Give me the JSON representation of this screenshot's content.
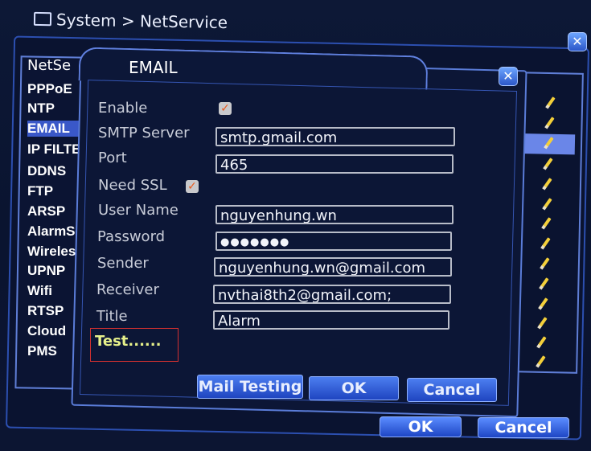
{
  "outer": {
    "title": "System > NetService",
    "close": "✕",
    "list_header": "NetSe",
    "list_items": [
      "PPPoE",
      "NTP",
      "EMAIL",
      "IP FILTER",
      "DDNS",
      "FTP",
      "ARSP",
      "AlarmServer",
      "Wireless",
      "UPNP",
      "Wifi",
      "RTSP",
      "Cloud",
      "PMS"
    ],
    "selected_item": "EMAIL",
    "ok_button": "OK",
    "cancel_button": "Cancel",
    "edit_icon": "pencil-icon"
  },
  "email": {
    "title": "EMAIL",
    "close": "✕",
    "labels": {
      "enable": "Enable",
      "smtp_server": "SMTP Server",
      "port": "Port",
      "need_ssl": "Need SSL",
      "user_name": "User Name",
      "password": "Password",
      "sender": "Sender",
      "receiver": "Receiver",
      "title": "Title"
    },
    "values": {
      "enable": true,
      "need_ssl": true,
      "smtp_server": "smtp.gmail.com",
      "port": "465",
      "user_name": "nguyenhung.wn",
      "password": "●●●●●●●",
      "sender": "nguyenhung.wn@gmail.com",
      "receiver": "nvthai8th2@gmail.com;",
      "title": "Alarm"
    },
    "check_mark": "✓",
    "test_text": "Test......",
    "mail_testing_button": "Mail Testing",
    "ok_button": "OK",
    "cancel_button": "Cancel"
  },
  "colors": {
    "background": "#0c1532",
    "accent": "#2b56c8",
    "selection": "#6a86e8",
    "test_highlight": "#d23030",
    "test_text": "#e6f08a"
  }
}
